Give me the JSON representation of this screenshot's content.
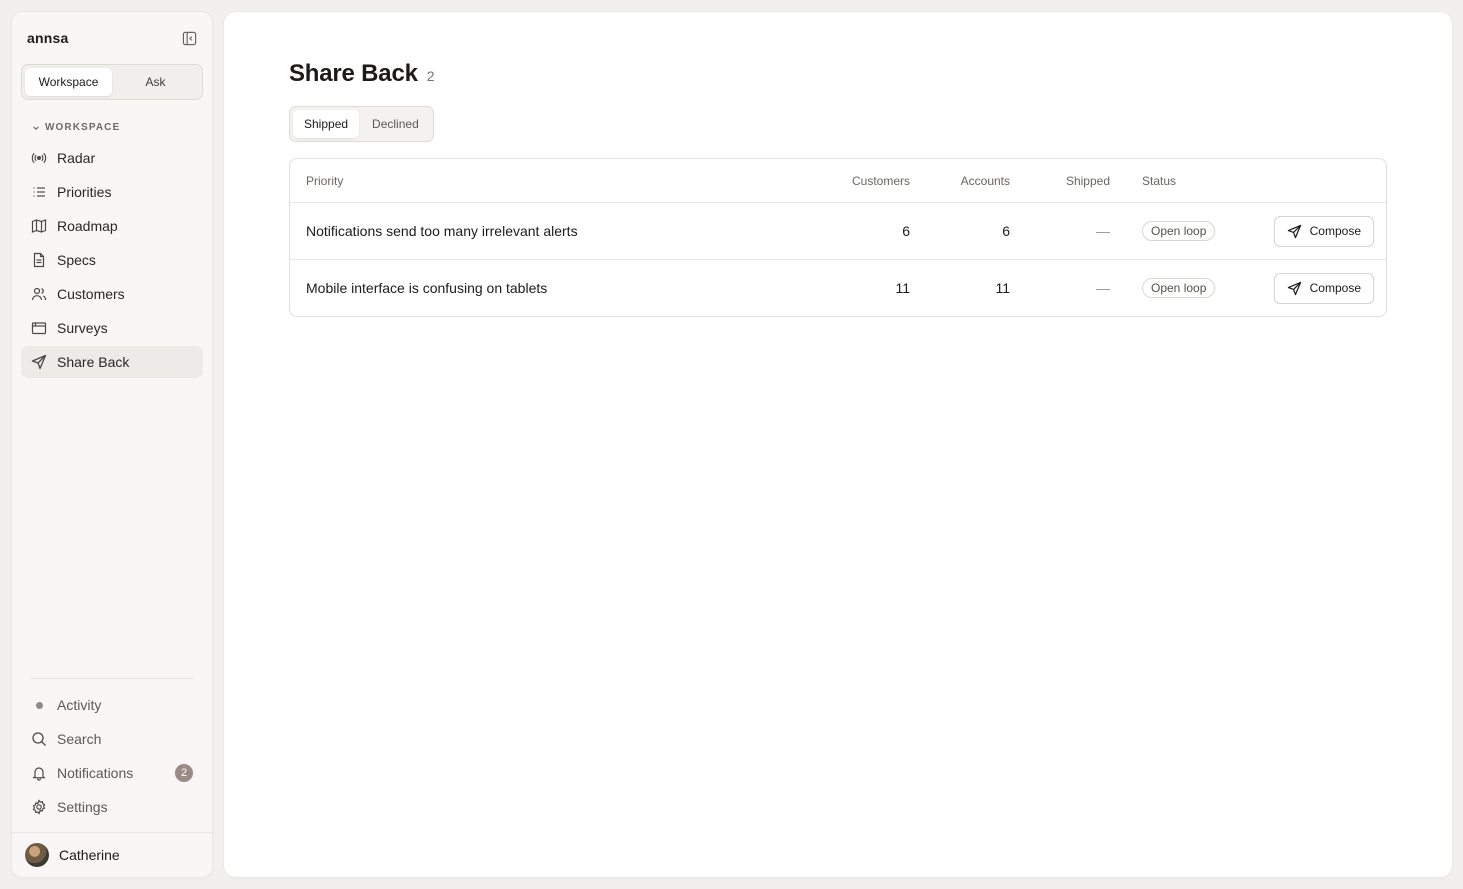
{
  "sidebar": {
    "brand": "annsa",
    "modes": [
      {
        "label": "Workspace",
        "active": true
      },
      {
        "label": "Ask",
        "active": false
      }
    ],
    "section_label": "WORKSPACE",
    "items": [
      {
        "label": "Radar",
        "icon": "radar-icon",
        "active": false
      },
      {
        "label": "Priorities",
        "icon": "list-icon",
        "active": false
      },
      {
        "label": "Roadmap",
        "icon": "map-icon",
        "active": false
      },
      {
        "label": "Specs",
        "icon": "document-icon",
        "active": false
      },
      {
        "label": "Customers",
        "icon": "users-icon",
        "active": false
      },
      {
        "label": "Surveys",
        "icon": "calendar-icon",
        "active": false
      },
      {
        "label": "Share Back",
        "icon": "send-icon",
        "active": true
      }
    ],
    "bottom_items": [
      {
        "label": "Activity",
        "icon": "dot-icon"
      },
      {
        "label": "Search",
        "icon": "search-icon"
      },
      {
        "label": "Notifications",
        "icon": "bell-icon",
        "badge": "2"
      },
      {
        "label": "Settings",
        "icon": "gear-icon"
      }
    ],
    "user": {
      "name": "Catherine"
    }
  },
  "main": {
    "title": "Share Back",
    "count": "2",
    "tabs": [
      {
        "label": "Shipped",
        "active": true
      },
      {
        "label": "Declined",
        "active": false
      }
    ],
    "table": {
      "columns": {
        "priority": "Priority",
        "customers": "Customers",
        "accounts": "Accounts",
        "shipped": "Shipped",
        "status": "Status"
      },
      "rows": [
        {
          "priority": "Notifications send too many irrelevant alerts",
          "customers": "6",
          "accounts": "6",
          "shipped": "—",
          "status": "Open loop",
          "action": "Compose"
        },
        {
          "priority": "Mobile interface is confusing on tablets",
          "customers": "11",
          "accounts": "11",
          "shipped": "—",
          "status": "Open loop",
          "action": "Compose"
        }
      ]
    }
  },
  "colors": {
    "background": "#f1f0ee",
    "sidebar": "#f8f7f5",
    "active_nav": "#ecebe8",
    "badge": "#9b8a86"
  }
}
